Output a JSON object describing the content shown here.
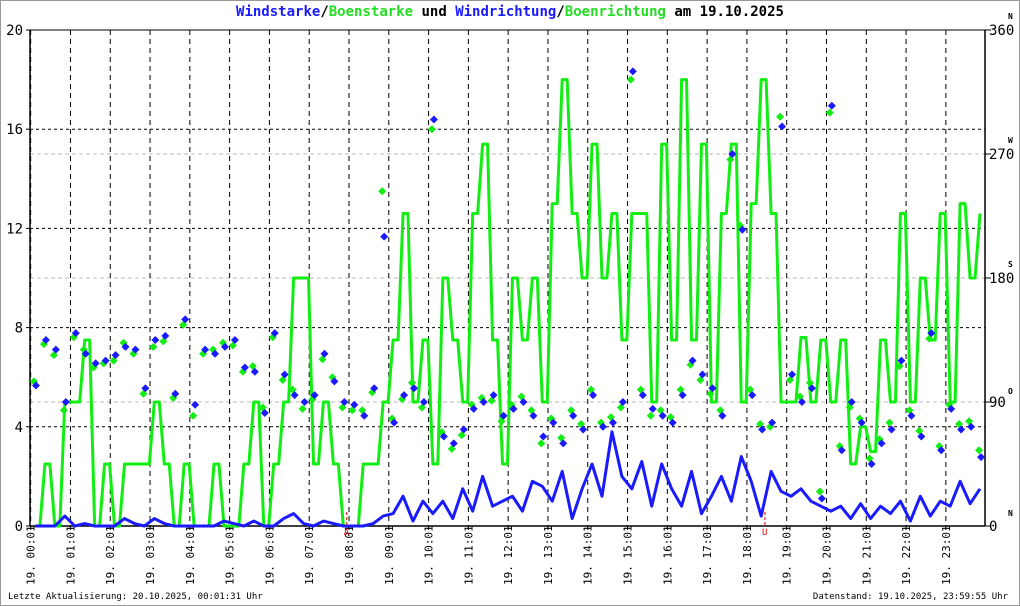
{
  "title": {
    "part1": "Windstarke",
    "sep1": "/",
    "part2": "Boenstarke",
    "mid": " und ",
    "part3": "Windrichtung",
    "sep2": "/",
    "part4": "Boenrichtung",
    "suffix": " am 19.10.2025"
  },
  "footer": {
    "left": "Letzte Aktualisierung: 20.10.2025, 00:01:31 Uhr",
    "right": "Datenstand: 19.10.2025, 23:59:55 Uhr"
  },
  "colors": {
    "wind": "#1a1aff",
    "gust": "#11ee11",
    "marker": "#dd0000"
  },
  "chart_data": {
    "type": "line",
    "title": "Windstarke/Boenstarke und Windrichtung/Boenrichtung am 19.10.2025",
    "x_unit": "hours",
    "xlim": [
      0,
      24
    ],
    "x_tick_labels": [
      "19. 00:01",
      "19. 01:01",
      "19. 02:01",
      "19. 03:01",
      "19. 04:01",
      "19. 05:01",
      "19. 06:01",
      "19. 07:01",
      "19. 08:01",
      "19. 09:01",
      "19. 10:01",
      "19. 11:01",
      "19. 12:01",
      "19. 13:01",
      "19. 14:01",
      "19. 15:01",
      "19. 16:01",
      "19. 17:01",
      "19. 18:01",
      "19. 19:01",
      "19. 20:01",
      "19. 21:01",
      "19. 22:01",
      "19. 23:01"
    ],
    "y_left": {
      "ylim": [
        0,
        20
      ],
      "ticks": [
        "0",
        "4",
        "8",
        "12",
        "16",
        "20"
      ]
    },
    "y_right": {
      "ylim": [
        0,
        360
      ],
      "ticks": [
        {
          "value": "0",
          "dir": "N"
        },
        {
          "value": "90",
          "dir": "O"
        },
        {
          "value": "180",
          "dir": "S"
        },
        {
          "value": "270",
          "dir": "W"
        },
        {
          "value": "360",
          "dir": "N"
        }
      ]
    },
    "sample_step_hours": 0.25,
    "series": [
      {
        "name": "Windstarke",
        "axis": "left",
        "style": "line",
        "color": "#1a1aff",
        "values": [
          0,
          0,
          0,
          0.4,
          0,
          0.1,
          0,
          0,
          0,
          0.3,
          0.1,
          0,
          0.3,
          0.1,
          0,
          0,
          0,
          0,
          0,
          0.2,
          0.1,
          0,
          0.2,
          0,
          0,
          0.3,
          0.5,
          0.1,
          0,
          0.2,
          0.1,
          0,
          0,
          0,
          0.1,
          0.4,
          0.5,
          1.2,
          0.2,
          1.0,
          0.5,
          1.0,
          0.3,
          1.5,
          0.6,
          2.0,
          0.8,
          1.0,
          1.2,
          0.6,
          1.8,
          1.6,
          1.0,
          2.2,
          0.3,
          1.5,
          2.5,
          1.2,
          3.8,
          2.0,
          1.5,
          2.6,
          0.8,
          2.5,
          1.5,
          0.8,
          2.2,
          0.5,
          1.2,
          2.0,
          1.0,
          2.8,
          1.8,
          0.4,
          2.2,
          1.4,
          1.2,
          1.5,
          1.0,
          0.8,
          0.6,
          0.8,
          0.3,
          0.9,
          0.3,
          0.8,
          0.5,
          1.0,
          0.2,
          1.2,
          0.4,
          1.0,
          0.8,
          1.8,
          0.9,
          1.5
        ]
      },
      {
        "name": "Boenstarke",
        "axis": "left",
        "style": "line",
        "color": "#11ee11",
        "values": [
          0,
          2.5,
          0,
          5,
          5,
          7.5,
          0,
          2.5,
          0,
          2.5,
          2.5,
          2.5,
          5,
          2.5,
          0,
          2.5,
          0,
          0,
          2.5,
          0,
          0,
          2.5,
          5,
          0,
          2.5,
          5,
          10,
          10,
          2.5,
          5,
          2.5,
          0,
          0,
          2.5,
          2.5,
          5,
          7.5,
          12.6,
          5,
          7.5,
          2.5,
          10,
          7.5,
          5,
          12.6,
          15.4,
          7.5,
          2.5,
          10,
          7.5,
          10,
          5,
          13,
          18,
          12.6,
          10,
          15.4,
          10,
          12.6,
          7.5,
          12.6,
          12.6,
          5,
          15.4,
          7.5,
          18,
          7.5,
          15.4,
          5,
          12.6,
          15.4,
          5,
          13,
          18,
          12.6,
          5,
          5,
          7.6,
          5,
          7.5,
          5,
          7.5,
          2.5,
          4,
          3,
          7.5,
          5,
          12.6,
          5,
          10,
          7.5,
          12.6,
          5,
          13,
          10,
          12.6
        ]
      },
      {
        "name": "Windrichtung",
        "axis": "right",
        "style": "diamond",
        "color": "#1a1aff",
        "values": [
          102,
          135,
          128,
          90,
          140,
          125,
          118,
          120,
          124,
          130,
          128,
          100,
          135,
          138,
          96,
          150,
          88,
          128,
          125,
          130,
          135,
          115,
          112,
          82,
          140,
          110,
          95,
          90,
          95,
          125,
          105,
          90,
          88,
          80,
          100,
          210,
          75,
          95,
          100,
          90,
          295,
          65,
          60,
          70,
          85,
          90,
          95,
          80,
          85,
          90,
          80,
          65,
          75,
          60,
          80,
          70,
          95,
          72,
          75,
          90,
          330,
          95,
          85,
          80,
          75,
          95,
          120,
          110,
          100,
          80,
          270,
          215,
          95,
          70,
          75,
          290,
          110,
          90,
          100,
          20,
          305,
          55,
          90,
          75,
          45,
          60,
          70,
          120,
          80,
          65,
          140,
          55,
          85,
          70,
          72,
          50
        ]
      },
      {
        "name": "Boenrichtung",
        "axis": "right",
        "style": "diamond",
        "color": "#11ee11",
        "values": [
          105,
          132,
          124,
          84,
          137,
          128,
          115,
          118,
          120,
          133,
          125,
          96,
          130,
          134,
          93,
          146,
          80,
          125,
          128,
          133,
          131,
          112,
          116,
          86,
          137,
          106,
          99,
          85,
          92,
          121,
          108,
          86,
          84,
          84,
          97,
          243,
          78,
          92,
          104,
          86,
          288,
          68,
          56,
          66,
          88,
          93,
          91,
          76,
          88,
          94,
          84,
          60,
          78,
          64,
          84,
          74,
          99,
          75,
          79,
          86,
          324,
          99,
          80,
          84,
          79,
          99,
          117,
          106,
          96,
          84,
          266,
          218,
          99,
          74,
          72,
          297,
          106,
          94,
          104,
          25,
          300,
          58,
          86,
          78,
          49,
          63,
          75,
          116,
          84,
          69,
          136,
          58,
          88,
          74,
          76,
          55
        ]
      }
    ],
    "annotations": [
      {
        "label": "A",
        "x_hours": 7.96,
        "meaning": "sunrise"
      },
      {
        "label": "U",
        "x_hours": 18.47,
        "meaning": "sunset"
      }
    ],
    "grid": true
  }
}
